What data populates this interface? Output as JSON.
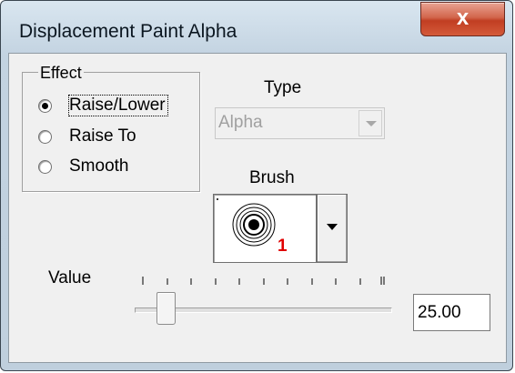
{
  "window": {
    "title": "Displacement Paint Alpha",
    "close_icon": "close-icon",
    "close_glyph": "x"
  },
  "effect": {
    "legend": "Effect",
    "options": [
      {
        "label": "Raise/Lower",
        "selected": true
      },
      {
        "label": "Raise To",
        "selected": false
      },
      {
        "label": "Smooth",
        "selected": false
      }
    ]
  },
  "type": {
    "label": "Type",
    "value": "Alpha",
    "disabled": true
  },
  "brush": {
    "label": "Brush",
    "number": "1",
    "number_color": "#e00000"
  },
  "value": {
    "label": "Value",
    "text": "25.00"
  }
}
